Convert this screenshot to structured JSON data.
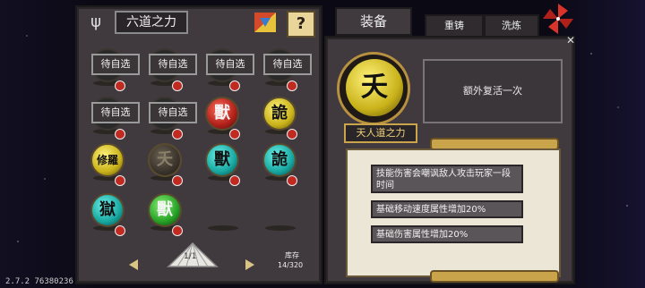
{
  "left": {
    "title": "六道之力",
    "help_label": "?",
    "pending_label": "待自选",
    "slots": [
      {
        "kind": "pending"
      },
      {
        "kind": "pending"
      },
      {
        "kind": "pending"
      },
      {
        "kind": "pending"
      },
      {
        "kind": "pending"
      },
      {
        "kind": "pending"
      },
      {
        "kind": "orb",
        "color": "red",
        "glyph": "獸"
      },
      {
        "kind": "orb",
        "color": "yellow",
        "glyph": "詭"
      },
      {
        "kind": "orb",
        "color": "yellow",
        "glyph": "修羅"
      },
      {
        "kind": "orb",
        "color": "dim",
        "glyph": "夭"
      },
      {
        "kind": "orb",
        "color": "teal",
        "glyph": "獸"
      },
      {
        "kind": "orb",
        "color": "teal",
        "glyph": "詭"
      },
      {
        "kind": "orb",
        "color": "teal",
        "glyph": "獄"
      },
      {
        "kind": "orb",
        "color": "green",
        "glyph": "獸"
      },
      {
        "kind": "empty"
      },
      {
        "kind": "empty"
      }
    ],
    "page": "1/1",
    "stock_label": "库存",
    "stock_count": "14/320"
  },
  "right": {
    "tabs": [
      "装备",
      "重铸",
      "洗炼"
    ],
    "item_glyph": "夭",
    "item_name": "天人道之力",
    "effect": "额外复活一次",
    "attributes": [
      "技能伤害会嘲讽敌人攻击玩家一段时间",
      "基础移动速度属性增加20%",
      "基础伤害属性增加20%"
    ]
  },
  "version": "2.7.2 76380236",
  "colors": {
    "panel": "#403a3f",
    "gold": "#c9a44a",
    "scroll": "#ece6d6",
    "badge": "#c02a20"
  },
  "icons": {
    "header": "wind-chime-icon",
    "deco": "colored-box-icon",
    "pinwheel": "pinwheel-icon",
    "close": "close-icon"
  }
}
